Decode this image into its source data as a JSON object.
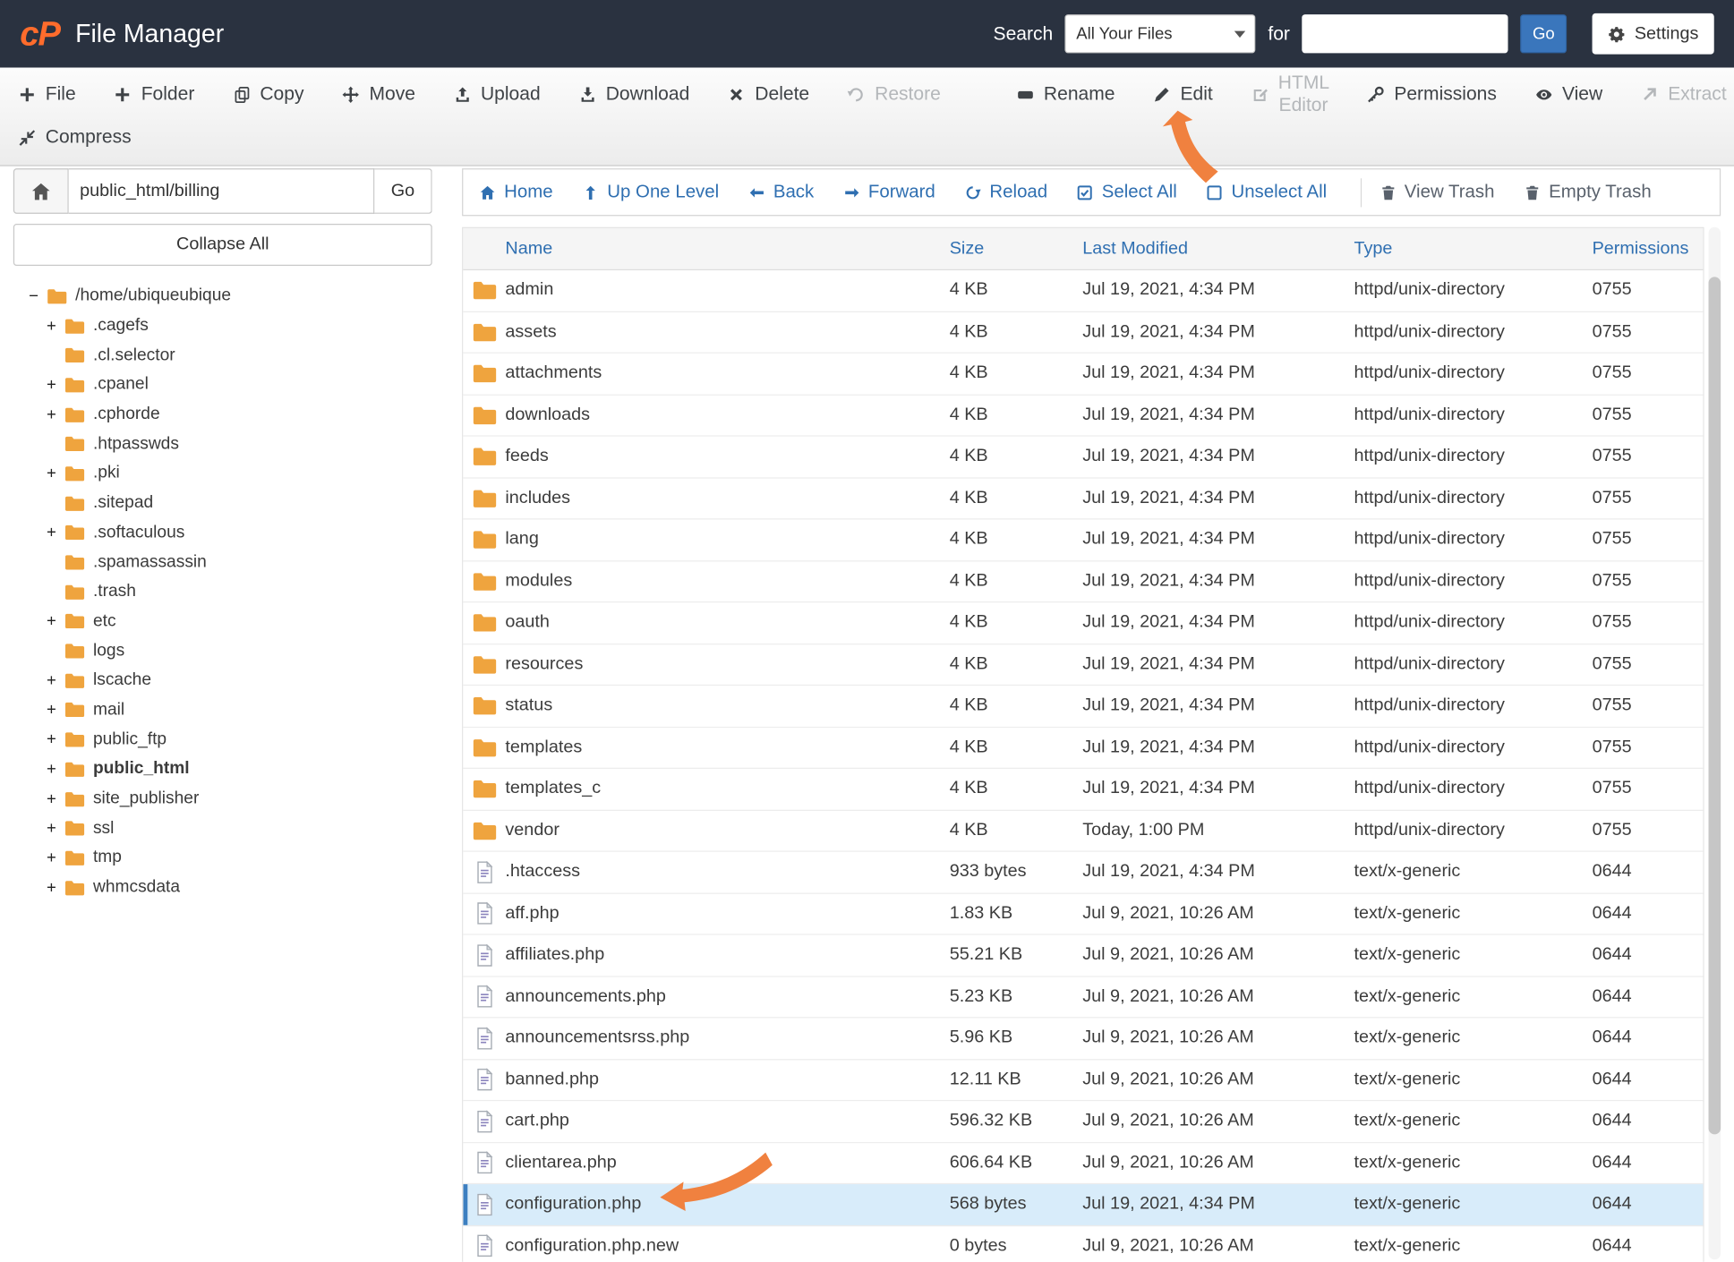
{
  "colors": {
    "header-bg": "#2a3240",
    "brand-orange": "#ff6c2c",
    "link-blue": "#2f6fb1",
    "button-blue": "#3a76bc",
    "folder-amber": "#efa43e",
    "selected-row": "#d8ecfa",
    "selected-edge": "#3d7fc0",
    "annotation-orange": "#f0813f"
  },
  "header": {
    "logo": "cP",
    "title": "File Manager",
    "search_label": "Search",
    "search_scope": "All Your Files",
    "for_label": "for",
    "search_value": "",
    "go": "Go",
    "settings": "Settings"
  },
  "toolbar": {
    "row1": [
      {
        "label": "File",
        "icon": "plus-icon",
        "enabled": true
      },
      {
        "label": "Folder",
        "icon": "plus-icon",
        "enabled": true
      },
      {
        "label": "Copy",
        "icon": "copy-icon",
        "enabled": true
      },
      {
        "label": "Move",
        "icon": "move-icon",
        "enabled": true
      },
      {
        "label": "Upload",
        "icon": "upload-icon",
        "enabled": true
      },
      {
        "label": "Download",
        "icon": "download-icon",
        "enabled": true
      },
      {
        "label": "Delete",
        "icon": "delete-icon",
        "enabled": true
      },
      {
        "label": "Restore",
        "icon": "restore-icon",
        "enabled": false
      },
      {
        "label": "Rename",
        "icon": "rename-icon",
        "enabled": true,
        "divider_before": true
      },
      {
        "label": "Edit",
        "icon": "edit-icon",
        "enabled": true
      },
      {
        "label": "HTML Editor",
        "icon": "html-editor-icon",
        "enabled": false
      },
      {
        "label": "Permissions",
        "icon": "permissions-icon",
        "enabled": true
      },
      {
        "label": "View",
        "icon": "view-icon",
        "enabled": true
      },
      {
        "label": "Extract",
        "icon": "extract-icon",
        "enabled": false
      }
    ],
    "row2": [
      {
        "label": "Compress",
        "icon": "compress-icon",
        "enabled": true
      }
    ]
  },
  "sidebar": {
    "path_value": "public_html/billing",
    "go": "Go",
    "collapse_all": "Collapse All",
    "tree": [
      {
        "label": "/home/ubiqueubique",
        "expander": "minus",
        "depth": 0
      },
      {
        "label": ".cagefs",
        "expander": "plus",
        "depth": 1
      },
      {
        "label": ".cl.selector",
        "expander": "none",
        "depth": 1
      },
      {
        "label": ".cpanel",
        "expander": "plus",
        "depth": 1
      },
      {
        "label": ".cphorde",
        "expander": "plus",
        "depth": 1
      },
      {
        "label": ".htpasswds",
        "expander": "none",
        "depth": 1
      },
      {
        "label": ".pki",
        "expander": "plus",
        "depth": 1
      },
      {
        "label": ".sitepad",
        "expander": "none",
        "depth": 1
      },
      {
        "label": ".softaculous",
        "expander": "plus",
        "depth": 1
      },
      {
        "label": ".spamassassin",
        "expander": "none",
        "depth": 1
      },
      {
        "label": ".trash",
        "expander": "none",
        "depth": 1
      },
      {
        "label": "etc",
        "expander": "plus",
        "depth": 1
      },
      {
        "label": "logs",
        "expander": "none",
        "depth": 1
      },
      {
        "label": "lscache",
        "expander": "plus",
        "depth": 1
      },
      {
        "label": "mail",
        "expander": "plus",
        "depth": 1
      },
      {
        "label": "public_ftp",
        "expander": "plus",
        "depth": 1
      },
      {
        "label": "public_html",
        "expander": "plus",
        "depth": 1,
        "bold": true
      },
      {
        "label": "site_publisher",
        "expander": "plus",
        "depth": 1
      },
      {
        "label": "ssl",
        "expander": "plus",
        "depth": 1
      },
      {
        "label": "tmp",
        "expander": "plus",
        "depth": 1
      },
      {
        "label": "whmcsdata",
        "expander": "plus",
        "depth": 1
      }
    ]
  },
  "filenav": {
    "left": [
      {
        "label": "Home",
        "icon": "home-icon"
      },
      {
        "label": "Up One Level",
        "icon": "up-one-level-icon"
      },
      {
        "label": "Back",
        "icon": "back-icon"
      },
      {
        "label": "Forward",
        "icon": "forward-icon"
      },
      {
        "label": "Reload",
        "icon": "reload-icon"
      },
      {
        "label": "Select All",
        "icon": "select-all-icon"
      },
      {
        "label": "Unselect All",
        "icon": "unselect-all-icon"
      }
    ],
    "right": [
      {
        "label": "View Trash",
        "icon": "view-trash-icon"
      },
      {
        "label": "Empty Trash",
        "icon": "empty-trash-icon"
      }
    ]
  },
  "table": {
    "headers": [
      "Name",
      "Size",
      "Last Modified",
      "Type",
      "Permissions"
    ],
    "rows": [
      {
        "name": "admin",
        "kind": "folder",
        "size": "4 KB",
        "modified": "Jul 19, 2021, 4:34 PM",
        "type": "httpd/unix-directory",
        "perms": "0755"
      },
      {
        "name": "assets",
        "kind": "folder",
        "size": "4 KB",
        "modified": "Jul 19, 2021, 4:34 PM",
        "type": "httpd/unix-directory",
        "perms": "0755"
      },
      {
        "name": "attachments",
        "kind": "folder",
        "size": "4 KB",
        "modified": "Jul 19, 2021, 4:34 PM",
        "type": "httpd/unix-directory",
        "perms": "0755"
      },
      {
        "name": "downloads",
        "kind": "folder",
        "size": "4 KB",
        "modified": "Jul 19, 2021, 4:34 PM",
        "type": "httpd/unix-directory",
        "perms": "0755"
      },
      {
        "name": "feeds",
        "kind": "folder",
        "size": "4 KB",
        "modified": "Jul 19, 2021, 4:34 PM",
        "type": "httpd/unix-directory",
        "perms": "0755"
      },
      {
        "name": "includes",
        "kind": "folder",
        "size": "4 KB",
        "modified": "Jul 19, 2021, 4:34 PM",
        "type": "httpd/unix-directory",
        "perms": "0755"
      },
      {
        "name": "lang",
        "kind": "folder",
        "size": "4 KB",
        "modified": "Jul 19, 2021, 4:34 PM",
        "type": "httpd/unix-directory",
        "perms": "0755"
      },
      {
        "name": "modules",
        "kind": "folder",
        "size": "4 KB",
        "modified": "Jul 19, 2021, 4:34 PM",
        "type": "httpd/unix-directory",
        "perms": "0755"
      },
      {
        "name": "oauth",
        "kind": "folder",
        "size": "4 KB",
        "modified": "Jul 19, 2021, 4:34 PM",
        "type": "httpd/unix-directory",
        "perms": "0755"
      },
      {
        "name": "resources",
        "kind": "folder",
        "size": "4 KB",
        "modified": "Jul 19, 2021, 4:34 PM",
        "type": "httpd/unix-directory",
        "perms": "0755"
      },
      {
        "name": "status",
        "kind": "folder",
        "size": "4 KB",
        "modified": "Jul 19, 2021, 4:34 PM",
        "type": "httpd/unix-directory",
        "perms": "0755"
      },
      {
        "name": "templates",
        "kind": "folder",
        "size": "4 KB",
        "modified": "Jul 19, 2021, 4:34 PM",
        "type": "httpd/unix-directory",
        "perms": "0755"
      },
      {
        "name": "templates_c",
        "kind": "folder",
        "size": "4 KB",
        "modified": "Jul 19, 2021, 4:34 PM",
        "type": "httpd/unix-directory",
        "perms": "0755"
      },
      {
        "name": "vendor",
        "kind": "folder",
        "size": "4 KB",
        "modified": "Today, 1:00 PM",
        "type": "httpd/unix-directory",
        "perms": "0755"
      },
      {
        "name": ".htaccess",
        "kind": "file",
        "size": "933 bytes",
        "modified": "Jul 19, 2021, 4:34 PM",
        "type": "text/x-generic",
        "perms": "0644"
      },
      {
        "name": "aff.php",
        "kind": "file",
        "size": "1.83 KB",
        "modified": "Jul 9, 2021, 10:26 AM",
        "type": "text/x-generic",
        "perms": "0644"
      },
      {
        "name": "affiliates.php",
        "kind": "file",
        "size": "55.21 KB",
        "modified": "Jul 9, 2021, 10:26 AM",
        "type": "text/x-generic",
        "perms": "0644"
      },
      {
        "name": "announcements.php",
        "kind": "file",
        "size": "5.23 KB",
        "modified": "Jul 9, 2021, 10:26 AM",
        "type": "text/x-generic",
        "perms": "0644"
      },
      {
        "name": "announcementsrss.php",
        "kind": "file",
        "size": "5.96 KB",
        "modified": "Jul 9, 2021, 10:26 AM",
        "type": "text/x-generic",
        "perms": "0644"
      },
      {
        "name": "banned.php",
        "kind": "file",
        "size": "12.11 KB",
        "modified": "Jul 9, 2021, 10:26 AM",
        "type": "text/x-generic",
        "perms": "0644"
      },
      {
        "name": "cart.php",
        "kind": "file",
        "size": "596.32 KB",
        "modified": "Jul 9, 2021, 10:26 AM",
        "type": "text/x-generic",
        "perms": "0644"
      },
      {
        "name": "clientarea.php",
        "kind": "file",
        "size": "606.64 KB",
        "modified": "Jul 9, 2021, 10:26 AM",
        "type": "text/x-generic",
        "perms": "0644"
      },
      {
        "name": "configuration.php",
        "kind": "file",
        "size": "568 bytes",
        "modified": "Jul 19, 2021, 4:34 PM",
        "type": "text/x-generic",
        "perms": "0644",
        "selected": true
      },
      {
        "name": "configuration.php.new",
        "kind": "file",
        "size": "0 bytes",
        "modified": "Jul 9, 2021, 10:26 AM",
        "type": "text/x-generic",
        "perms": "0644"
      }
    ]
  }
}
